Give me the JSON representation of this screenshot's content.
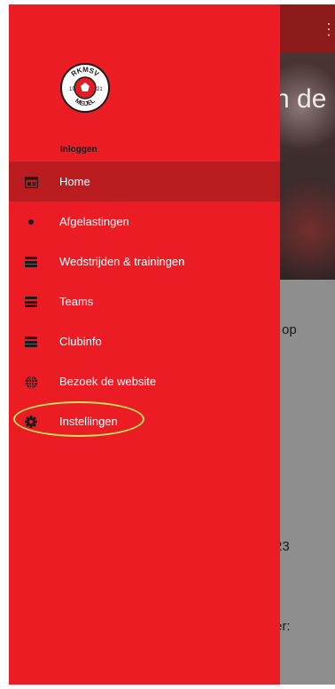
{
  "background": {
    "hero_text": "n de",
    "body_lines": [
      {
        "text": "op"
      },
      {
        "text": "23"
      },
      {
        "text": "er:"
      }
    ]
  },
  "drawer": {
    "login_label": "Inloggen",
    "logo_text_top": "RKMSV",
    "logo_text_bottom": "MEIJEL",
    "logo_year_left": "19",
    "logo_year_right": "21",
    "items": [
      {
        "label": "Home",
        "icon": "home-icon",
        "active": true
      },
      {
        "label": "Afgelastingen",
        "icon": "dot-icon",
        "active": false
      },
      {
        "label": "Wedstrijden & trainingen",
        "icon": "list-icon",
        "active": false
      },
      {
        "label": "Teams",
        "icon": "list-icon",
        "active": false
      },
      {
        "label": "Clubinfo",
        "icon": "list-icon",
        "active": false
      },
      {
        "label": "Bezoek de website",
        "icon": "globe-icon",
        "active": false
      },
      {
        "label": "Instellingen",
        "icon": "gear-icon",
        "active": false
      }
    ]
  },
  "colors": {
    "drawer": "#ec1c24",
    "active_item": "#bb1c1f",
    "highlight_ring": "#c8e060"
  }
}
